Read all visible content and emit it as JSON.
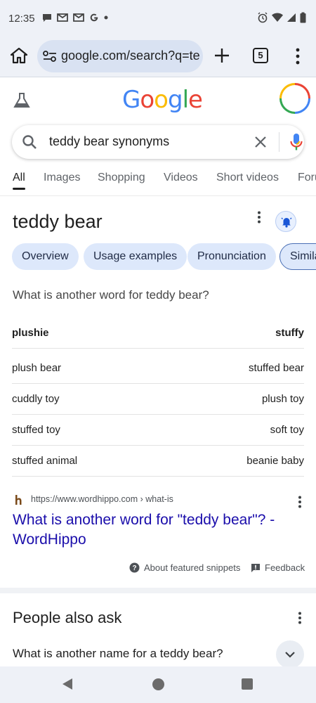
{
  "status_bar": {
    "time": "12:35",
    "left_icons": [
      "chat-bubble-icon",
      "gmail-icon",
      "gmail-icon",
      "google-g-icon",
      "dot-icon"
    ],
    "right_icons": [
      "alarm-icon",
      "wifi-icon",
      "cell-signal-icon",
      "battery-icon"
    ]
  },
  "browser": {
    "url": "google.com/search?q=te",
    "tab_count": "5"
  },
  "google": {
    "logo_letters": [
      {
        "ch": "G",
        "color": "#4285F4"
      },
      {
        "ch": "o",
        "color": "#EA4335"
      },
      {
        "ch": "o",
        "color": "#FBBC05"
      },
      {
        "ch": "g",
        "color": "#4285F4"
      },
      {
        "ch": "l",
        "color": "#34A853"
      },
      {
        "ch": "e",
        "color": "#EA4335"
      }
    ]
  },
  "search": {
    "query": "teddy bear synonyms"
  },
  "search_tabs": [
    "All",
    "Images",
    "Shopping",
    "Videos",
    "Short videos",
    "Forums"
  ],
  "featured": {
    "title": "teddy bear",
    "chips": [
      "Overview",
      "Usage examples",
      "Pronunciation",
      "Similar"
    ],
    "question": "What is another word for teddy bear?",
    "header_row": {
      "left": "plushie",
      "right": "stuffy"
    },
    "rows": [
      {
        "left": "plush bear",
        "right": "stuffed bear"
      },
      {
        "left": "cuddly toy",
        "right": "plush toy"
      },
      {
        "left": "stuffed toy",
        "right": "soft toy"
      },
      {
        "left": "stuffed animal",
        "right": "beanie baby"
      }
    ],
    "source_url": "https://www.wordhippo.com › what-is",
    "source_title": "What is another word for \"teddy bear\"? - WordHippo",
    "about_snippets": "About featured snippets",
    "feedback": "Feedback"
  },
  "people_also_ask": {
    "title": "People also ask",
    "question": "What is another name for a teddy bear?"
  },
  "colors": {
    "link": "#1a0dab",
    "chip_bg": "#dde8fb",
    "browser_chrome": "#eef1f7"
  }
}
